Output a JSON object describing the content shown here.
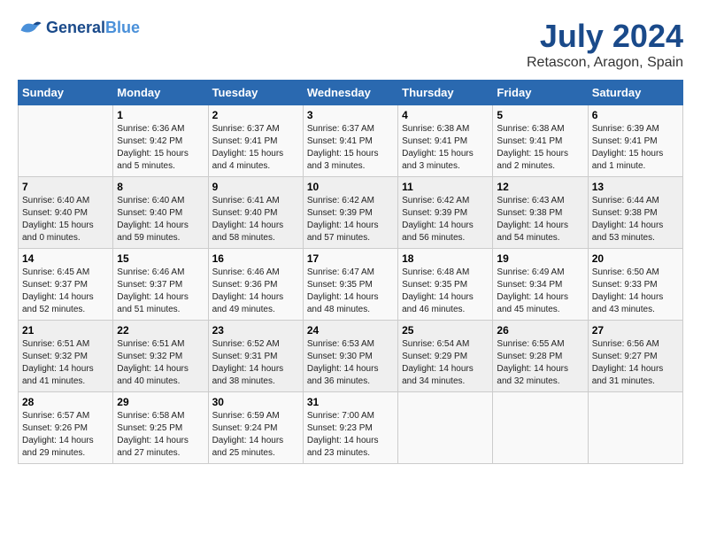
{
  "header": {
    "logo_line1": "General",
    "logo_line2": "Blue",
    "month_year": "July 2024",
    "location": "Retascon, Aragon, Spain"
  },
  "days_of_week": [
    "Sunday",
    "Monday",
    "Tuesday",
    "Wednesday",
    "Thursday",
    "Friday",
    "Saturday"
  ],
  "weeks": [
    [
      {
        "day": "",
        "info": ""
      },
      {
        "day": "1",
        "info": "Sunrise: 6:36 AM\nSunset: 9:42 PM\nDaylight: 15 hours\nand 5 minutes."
      },
      {
        "day": "2",
        "info": "Sunrise: 6:37 AM\nSunset: 9:41 PM\nDaylight: 15 hours\nand 4 minutes."
      },
      {
        "day": "3",
        "info": "Sunrise: 6:37 AM\nSunset: 9:41 PM\nDaylight: 15 hours\nand 3 minutes."
      },
      {
        "day": "4",
        "info": "Sunrise: 6:38 AM\nSunset: 9:41 PM\nDaylight: 15 hours\nand 3 minutes."
      },
      {
        "day": "5",
        "info": "Sunrise: 6:38 AM\nSunset: 9:41 PM\nDaylight: 15 hours\nand 2 minutes."
      },
      {
        "day": "6",
        "info": "Sunrise: 6:39 AM\nSunset: 9:41 PM\nDaylight: 15 hours\nand 1 minute."
      }
    ],
    [
      {
        "day": "7",
        "info": "Sunrise: 6:40 AM\nSunset: 9:40 PM\nDaylight: 15 hours\nand 0 minutes."
      },
      {
        "day": "8",
        "info": "Sunrise: 6:40 AM\nSunset: 9:40 PM\nDaylight: 14 hours\nand 59 minutes."
      },
      {
        "day": "9",
        "info": "Sunrise: 6:41 AM\nSunset: 9:40 PM\nDaylight: 14 hours\nand 58 minutes."
      },
      {
        "day": "10",
        "info": "Sunrise: 6:42 AM\nSunset: 9:39 PM\nDaylight: 14 hours\nand 57 minutes."
      },
      {
        "day": "11",
        "info": "Sunrise: 6:42 AM\nSunset: 9:39 PM\nDaylight: 14 hours\nand 56 minutes."
      },
      {
        "day": "12",
        "info": "Sunrise: 6:43 AM\nSunset: 9:38 PM\nDaylight: 14 hours\nand 54 minutes."
      },
      {
        "day": "13",
        "info": "Sunrise: 6:44 AM\nSunset: 9:38 PM\nDaylight: 14 hours\nand 53 minutes."
      }
    ],
    [
      {
        "day": "14",
        "info": "Sunrise: 6:45 AM\nSunset: 9:37 PM\nDaylight: 14 hours\nand 52 minutes."
      },
      {
        "day": "15",
        "info": "Sunrise: 6:46 AM\nSunset: 9:37 PM\nDaylight: 14 hours\nand 51 minutes."
      },
      {
        "day": "16",
        "info": "Sunrise: 6:46 AM\nSunset: 9:36 PM\nDaylight: 14 hours\nand 49 minutes."
      },
      {
        "day": "17",
        "info": "Sunrise: 6:47 AM\nSunset: 9:35 PM\nDaylight: 14 hours\nand 48 minutes."
      },
      {
        "day": "18",
        "info": "Sunrise: 6:48 AM\nSunset: 9:35 PM\nDaylight: 14 hours\nand 46 minutes."
      },
      {
        "day": "19",
        "info": "Sunrise: 6:49 AM\nSunset: 9:34 PM\nDaylight: 14 hours\nand 45 minutes."
      },
      {
        "day": "20",
        "info": "Sunrise: 6:50 AM\nSunset: 9:33 PM\nDaylight: 14 hours\nand 43 minutes."
      }
    ],
    [
      {
        "day": "21",
        "info": "Sunrise: 6:51 AM\nSunset: 9:32 PM\nDaylight: 14 hours\nand 41 minutes."
      },
      {
        "day": "22",
        "info": "Sunrise: 6:51 AM\nSunset: 9:32 PM\nDaylight: 14 hours\nand 40 minutes."
      },
      {
        "day": "23",
        "info": "Sunrise: 6:52 AM\nSunset: 9:31 PM\nDaylight: 14 hours\nand 38 minutes."
      },
      {
        "day": "24",
        "info": "Sunrise: 6:53 AM\nSunset: 9:30 PM\nDaylight: 14 hours\nand 36 minutes."
      },
      {
        "day": "25",
        "info": "Sunrise: 6:54 AM\nSunset: 9:29 PM\nDaylight: 14 hours\nand 34 minutes."
      },
      {
        "day": "26",
        "info": "Sunrise: 6:55 AM\nSunset: 9:28 PM\nDaylight: 14 hours\nand 32 minutes."
      },
      {
        "day": "27",
        "info": "Sunrise: 6:56 AM\nSunset: 9:27 PM\nDaylight: 14 hours\nand 31 minutes."
      }
    ],
    [
      {
        "day": "28",
        "info": "Sunrise: 6:57 AM\nSunset: 9:26 PM\nDaylight: 14 hours\nand 29 minutes."
      },
      {
        "day": "29",
        "info": "Sunrise: 6:58 AM\nSunset: 9:25 PM\nDaylight: 14 hours\nand 27 minutes."
      },
      {
        "day": "30",
        "info": "Sunrise: 6:59 AM\nSunset: 9:24 PM\nDaylight: 14 hours\nand 25 minutes."
      },
      {
        "day": "31",
        "info": "Sunrise: 7:00 AM\nSunset: 9:23 PM\nDaylight: 14 hours\nand 23 minutes."
      },
      {
        "day": "",
        "info": ""
      },
      {
        "day": "",
        "info": ""
      },
      {
        "day": "",
        "info": ""
      }
    ]
  ]
}
